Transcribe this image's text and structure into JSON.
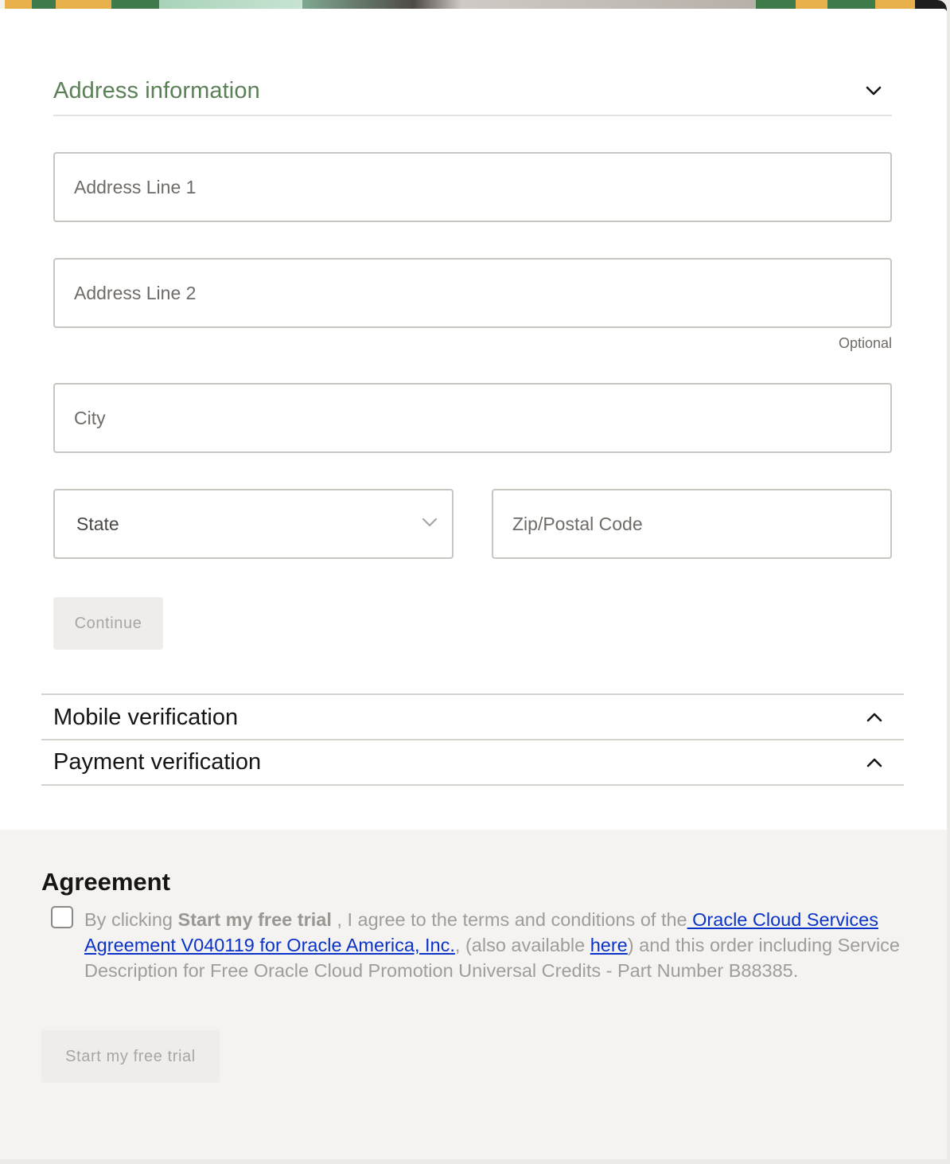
{
  "address": {
    "title": "Address information",
    "fields": {
      "address1_placeholder": "Address Line 1",
      "address2_placeholder": "Address Line 2",
      "address2_hint": "Optional",
      "city_placeholder": "City",
      "state_selected": "State",
      "zip_placeholder": "Zip/Postal Code"
    },
    "continue_label": "Continue"
  },
  "sections": {
    "mobile_title": "Mobile verification",
    "payment_title": "Payment verification"
  },
  "agreement": {
    "title": "Agreement",
    "text_1": "By clicking ",
    "bold": "Start my free trial",
    "text_2": " , I agree to the terms and conditions of the",
    "link_1": " Oracle Cloud Services Agreement V040119 for Oracle America, Inc.",
    "text_3": ", (also available ",
    "link_2": "here",
    "text_4": ") and this order including Service Description for Free Oracle Cloud Promotion Universal Credits - Part Number B88385.",
    "start_label": "Start my free trial"
  },
  "icons": {
    "address_chevron": "chevron-down-icon",
    "state_chevron": "chevron-down-icon",
    "mobile_chevron": "chevron-up-icon",
    "payment_chevron": "chevron-up-icon"
  },
  "colors": {
    "accent_green": "#5b7f57",
    "link_blue": "#0a33c9",
    "footer_bg": "#f4f3f1"
  }
}
